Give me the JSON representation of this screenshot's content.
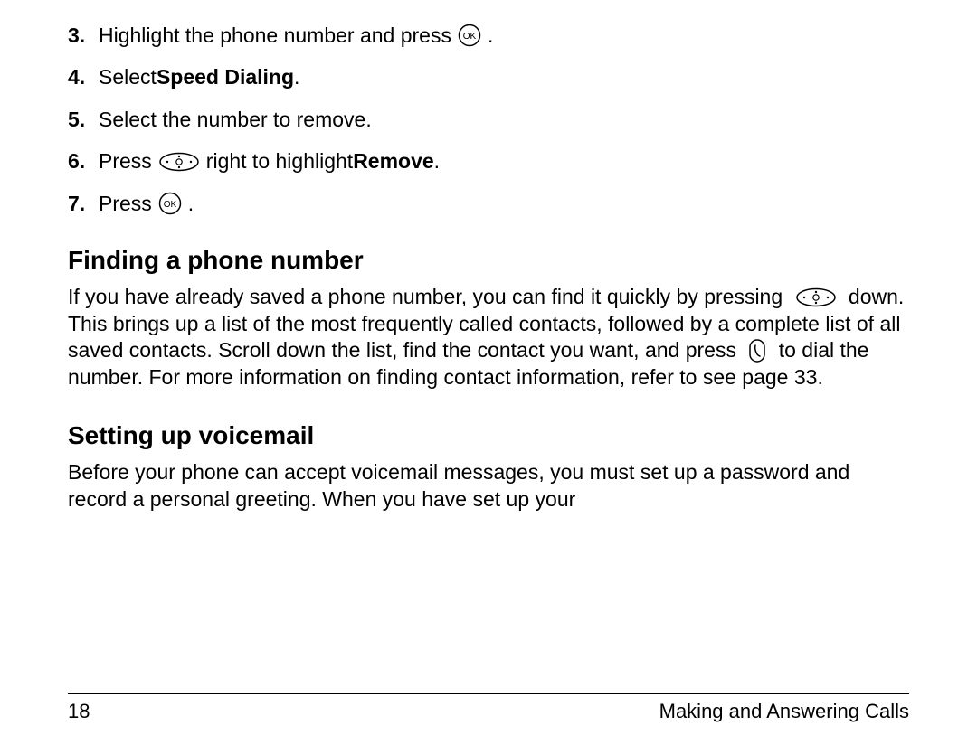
{
  "steps": [
    {
      "num": "3.",
      "pre": "Highlight the phone number and press ",
      "icon": "ok",
      "post": " ."
    },
    {
      "num": "4.",
      "pre": "Select ",
      "bold": "Speed Dialing",
      "post2": "."
    },
    {
      "num": "5.",
      "pre": "Select the number to remove."
    },
    {
      "num": "6.",
      "pre": "Press ",
      "icon": "nav",
      "mid": " right to highlight ",
      "bold": "Remove",
      "post2": "."
    },
    {
      "num": "7.",
      "pre": "Press ",
      "icon": "ok",
      "post": " ."
    }
  ],
  "section1": {
    "heading": "Finding a phone number",
    "p_a": "If you have already saved a phone number, you can find it quickly by pressing ",
    "p_b": " down. This brings up a list of the most frequently called contacts, followed by a complete list of all saved contacts. Scroll down the list, find the contact you want, and press ",
    "p_c": " to dial the number. For more information on finding contact information, refer to see page 33."
  },
  "section2": {
    "heading": "Setting up voicemail",
    "p": "Before your phone can accept voicemail messages, you must set up a password and record a personal greeting. When you have set up your"
  },
  "footer": {
    "page": "18",
    "chapter": "Making and Answering Calls"
  },
  "icons": {
    "ok": "OK",
    "nav": "NAV",
    "call": "CALL"
  }
}
